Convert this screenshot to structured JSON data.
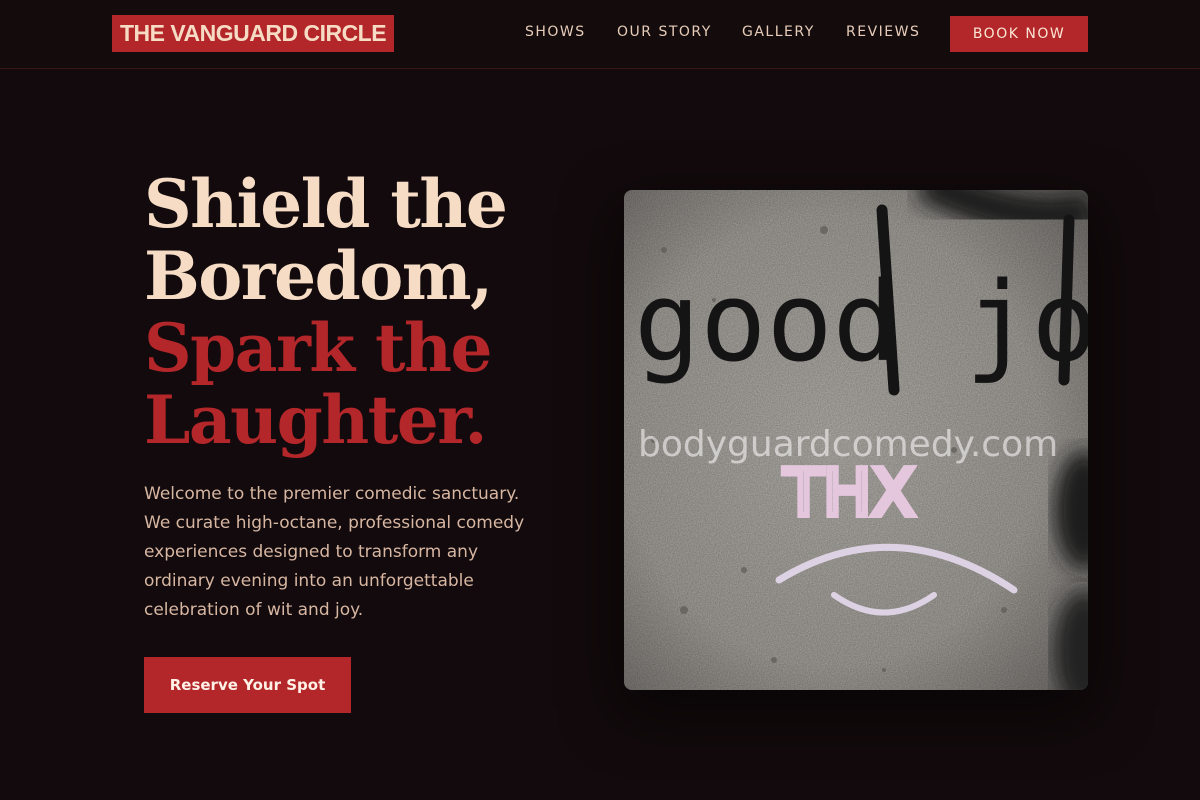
{
  "brand": {
    "name": "THE VANGUARD CIRCLE"
  },
  "nav": {
    "items": [
      {
        "label": "SHOWS"
      },
      {
        "label": "OUR STORY"
      },
      {
        "label": "GALLERY"
      },
      {
        "label": "REVIEWS"
      }
    ],
    "book_label": "BOOK NOW"
  },
  "hero": {
    "headline_line1": "Shield the",
    "headline_line2": "Boredom,",
    "headline_line3": "Spark the",
    "headline_line4": "Laughter.",
    "intro": "Welcome to the premier comedic sanctuary. We curate high-octane, professional comedy experiences designed to transform any ordinary evening into an unforgettable celebration of wit and joy.",
    "cta_label": "Reserve Your Spot",
    "image": {
      "graffiti_text": "good joke",
      "graffiti_text_2": "THX",
      "watermark": "bodyguardcomedy.com"
    }
  },
  "colors": {
    "background": "#120a0c",
    "accent": "#b3262a",
    "cream": "#f6dcc5",
    "muted": "#d7b6a2"
  }
}
